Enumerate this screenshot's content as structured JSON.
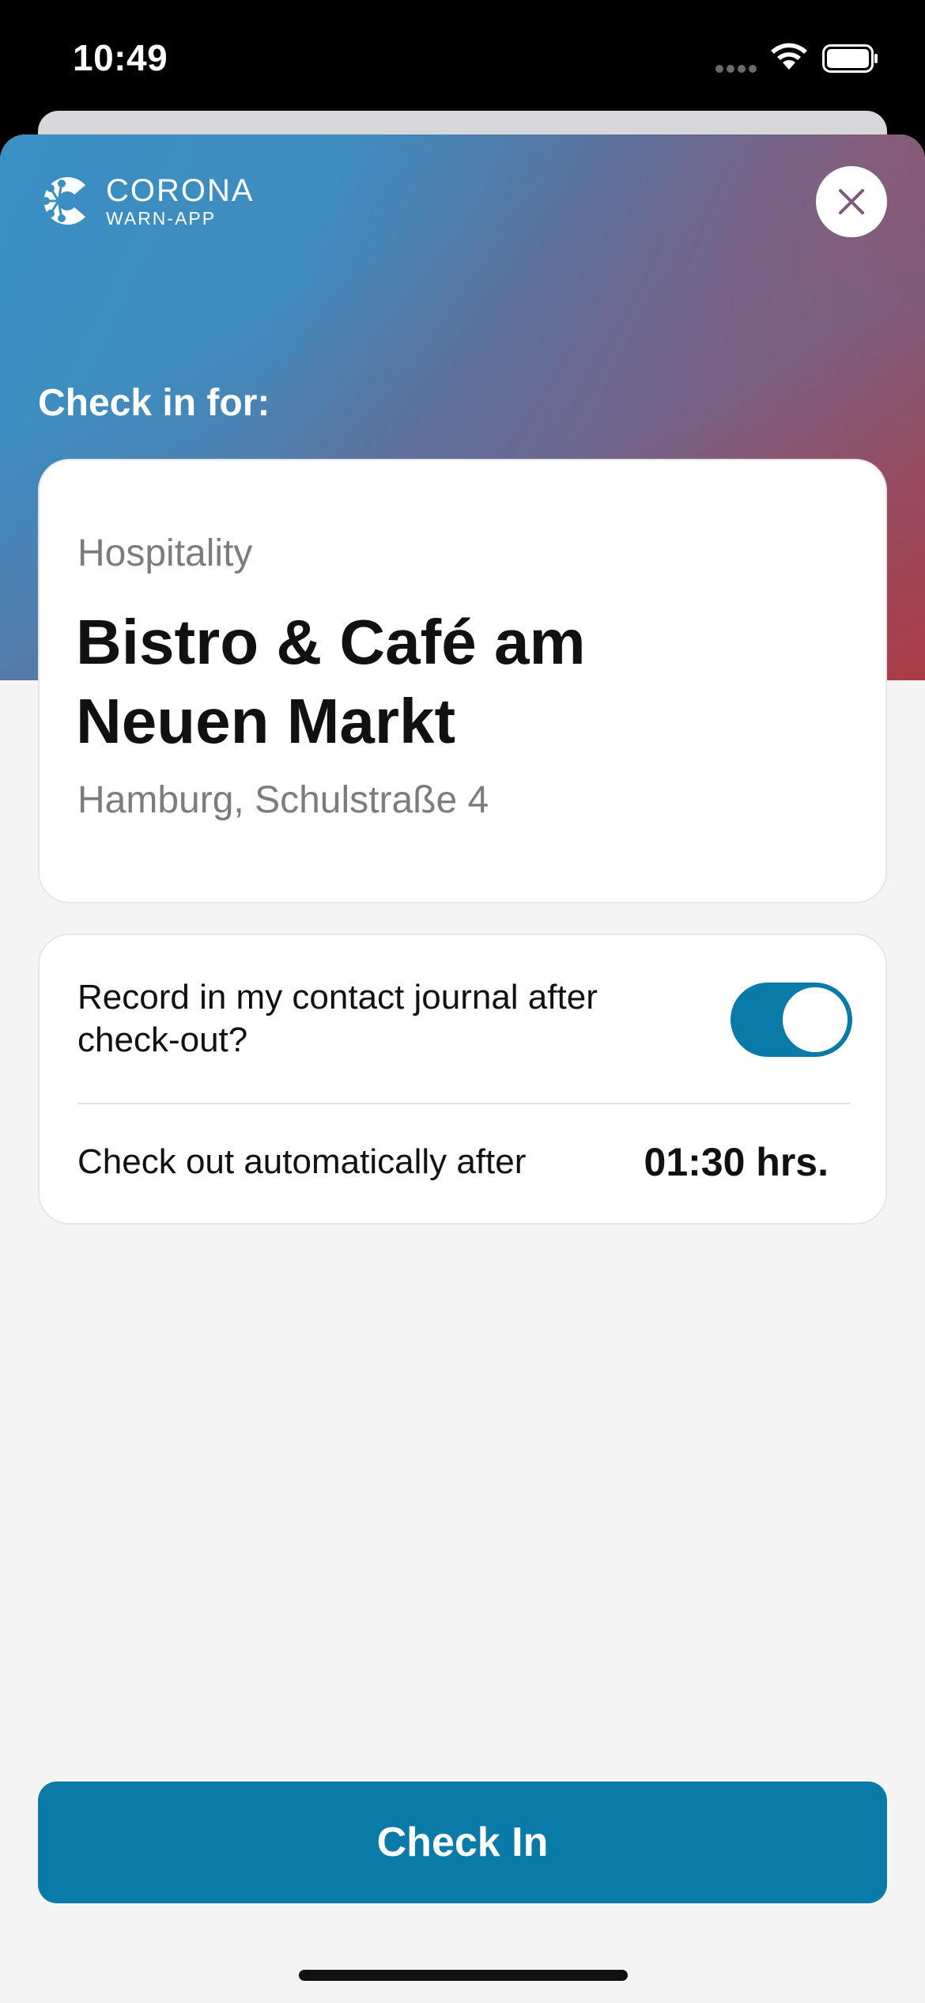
{
  "status_bar": {
    "time": "10:49"
  },
  "header": {
    "logo_line1": "CORONA",
    "logo_line2": "WARN-APP",
    "subtitle": "Check in for:"
  },
  "venue": {
    "type": "Hospitality",
    "name": "Bistro & Café am Neuen Markt",
    "address": "Hamburg, Schulstraße 4"
  },
  "options": {
    "journal_label": "Record in my contact journal after check-out?",
    "journal_enabled": true,
    "checkout_label": "Check out automatically after",
    "checkout_value": "01:30 hrs."
  },
  "actions": {
    "checkin_label": "Check In"
  },
  "colors": {
    "accent": "#0a7aa8",
    "background": "#f4f4f4",
    "gradient_start": "#3a8fc3",
    "gradient_end": "#ac4045"
  }
}
